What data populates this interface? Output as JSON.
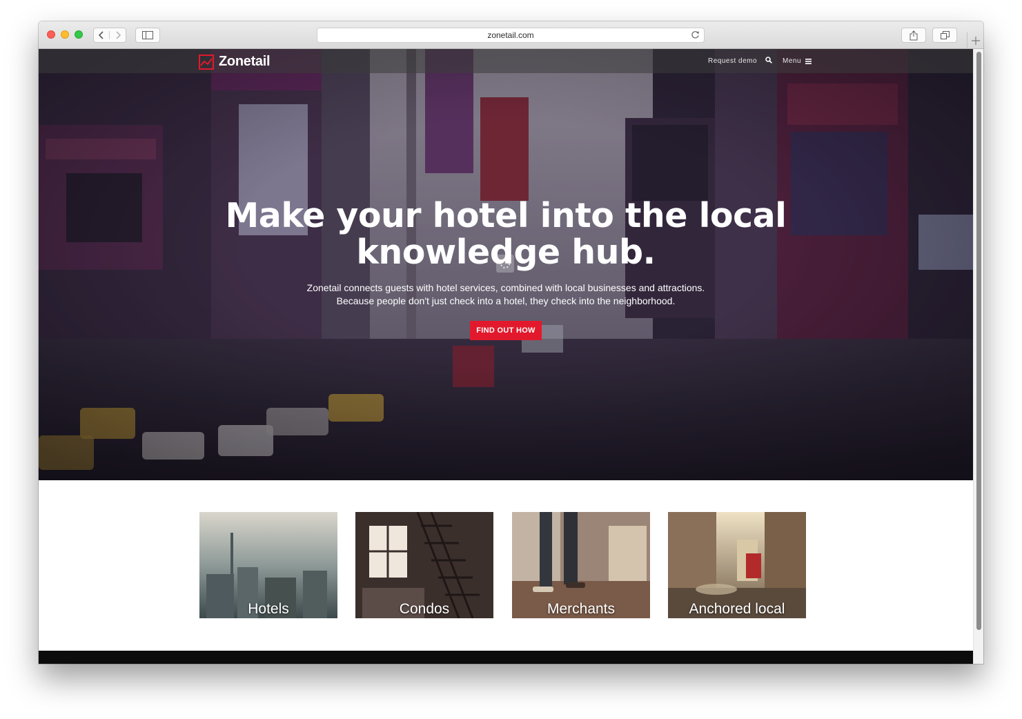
{
  "browser": {
    "url": "zonetail.com"
  },
  "nav": {
    "brand": "Zonetail",
    "request_demo": "Request demo",
    "menu": "Menu"
  },
  "hero": {
    "title": "Make your hotel into the local knowledge hub.",
    "subtitle_line1": "Zonetail connects guests with hotel services, combined with local businesses and attractions.",
    "subtitle_line2": "Because people don't just check into a hotel, they check into the neighborhood.",
    "cta": "FIND OUT HOW"
  },
  "cards": [
    {
      "label": "Hotels"
    },
    {
      "label": "Condos"
    },
    {
      "label": "Merchants"
    },
    {
      "label": "Anchored local"
    }
  ],
  "colors": {
    "accent": "#e2192c"
  }
}
